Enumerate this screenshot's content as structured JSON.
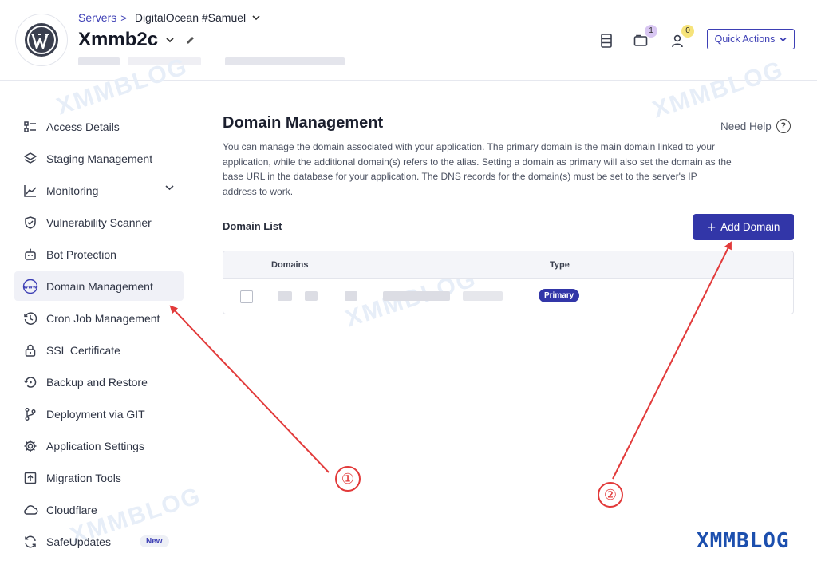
{
  "header": {
    "breadcrumb_link": "Servers",
    "breadcrumb_sep": ">",
    "server_name": "DigitalOcean #Samuel",
    "app_title": "Xmmb2c",
    "notif_count": "1",
    "user_count": "0",
    "quick_actions": "Quick Actions"
  },
  "sidebar": {
    "items": [
      {
        "label": "Access Details",
        "icon": "access-icon"
      },
      {
        "label": "Staging Management",
        "icon": "layers-icon"
      },
      {
        "label": "Monitoring",
        "icon": "chart-icon"
      },
      {
        "label": "Vulnerability Scanner",
        "icon": "shield-icon"
      },
      {
        "label": "Bot Protection",
        "icon": "robot-icon"
      },
      {
        "label": "Domain Management",
        "icon": "www-icon"
      },
      {
        "label": "Cron Job Management",
        "icon": "clock-history-icon"
      },
      {
        "label": "SSL Certificate",
        "icon": "lock-icon"
      },
      {
        "label": "Backup and Restore",
        "icon": "restore-icon"
      },
      {
        "label": "Deployment via GIT",
        "icon": "git-branch-icon"
      },
      {
        "label": "Application Settings",
        "icon": "gear-icon"
      },
      {
        "label": "Migration Tools",
        "icon": "upload-icon"
      },
      {
        "label": "Cloudflare",
        "icon": "cloud-icon"
      },
      {
        "label": "SafeUpdates",
        "icon": "refresh-icon"
      }
    ],
    "new_badge": "New"
  },
  "main": {
    "title": "Domain Management",
    "need_help": "Need Help",
    "description": "You can manage the domain associated with your application. The primary domain is the main domain linked to your application, while the additional domain(s) refers to the alias. Setting a domain as primary will also set the domain as the base URL in the database for your application. The DNS records for the domain(s) must be set to the server's IP address to work.",
    "domain_list_title": "Domain List",
    "add_domain": "Add Domain",
    "table": {
      "col_domains": "Domains",
      "col_type": "Type",
      "rows": [
        {
          "type": "Primary"
        }
      ]
    }
  },
  "watermark": "XMMBLOG",
  "annotations": [
    "①",
    "②"
  ],
  "colors": {
    "accent": "#3236a8",
    "annotation": "#e23a3a"
  }
}
